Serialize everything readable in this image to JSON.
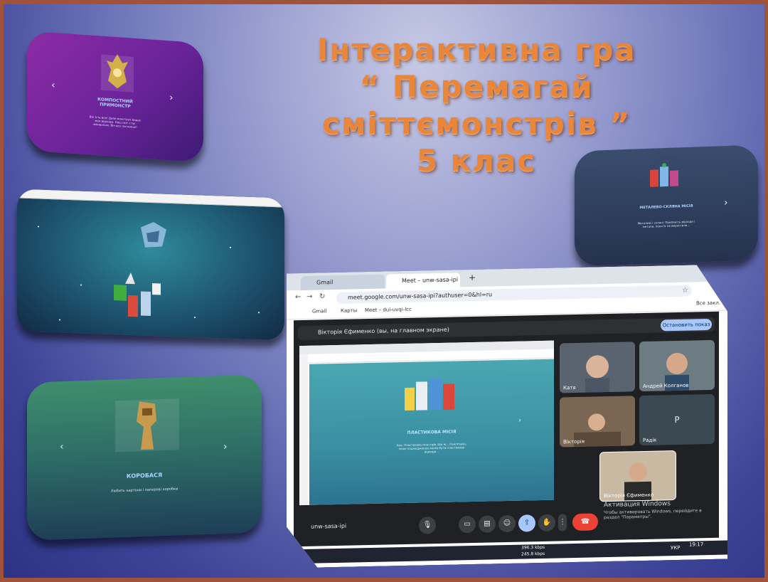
{
  "title": {
    "line1": "Інтерактивна гра",
    "line2": "“ Перемагай",
    "line3": "сміттємонстрів  ”",
    "line4": "5 клас"
  },
  "cards": [
    {
      "label": "КОМПОСТНИЙ ПРИМОНСТР",
      "text": "Він їсть все! Деяк монстрах видає моя відходи. Наш світ стає вживаним. Він все поглинає!"
    },
    {
      "label": "",
      "text": ""
    },
    {
      "label": "КОРОБАСЯ",
      "text": "Любить картони і паперові коробки"
    },
    {
      "label": "МЕТАЛЕВО-СКЛЯНА МІСІЯ",
      "text": "Металеві і скляні. Припиніть відходи і метали, поки їх не виростили..."
    }
  ],
  "chrome": {
    "tabs": [
      "Gmail",
      "Meet – unw-sasa-ipi"
    ],
    "new_tab": "+",
    "url": "meet.google.com/unw-sasa-ipi?authuser=0&hl=ru",
    "bookmarks": [
      "Gmail",
      "Карты",
      "Meet – dui-uvqi-lcc"
    ],
    "all_bookmarks": "Все закл."
  },
  "meet": {
    "presenter_text": "Вікторія Єфименко (вы, на главном экране)",
    "stop_button": "Остановить показ",
    "meeting_code": "unw-sasa-ipi",
    "shared_label": "ПЛАСТИКОВА МІСІЯ",
    "shared_text": "Ало. Пластикова монстрів. Що ж... Пам'ятаєш, якою пошкодженою може бути пластикова відходи...",
    "participants": [
      {
        "name": "Катя"
      },
      {
        "name": "Андрей Колганов"
      },
      {
        "name": "Вікторія"
      },
      {
        "name": "Радік",
        "initial": "P"
      },
      {
        "name": "Вікторія Єфименко"
      }
    ],
    "activation_title": "Активация Windows",
    "activation_text": "Чтобы активировать Windows, перейдите в раздел \"Параметры\"."
  },
  "taskbar": {
    "net_up": "396.3 kbps",
    "net_down": "245.8 kbps",
    "lang": "УКР",
    "time": "19:17"
  }
}
